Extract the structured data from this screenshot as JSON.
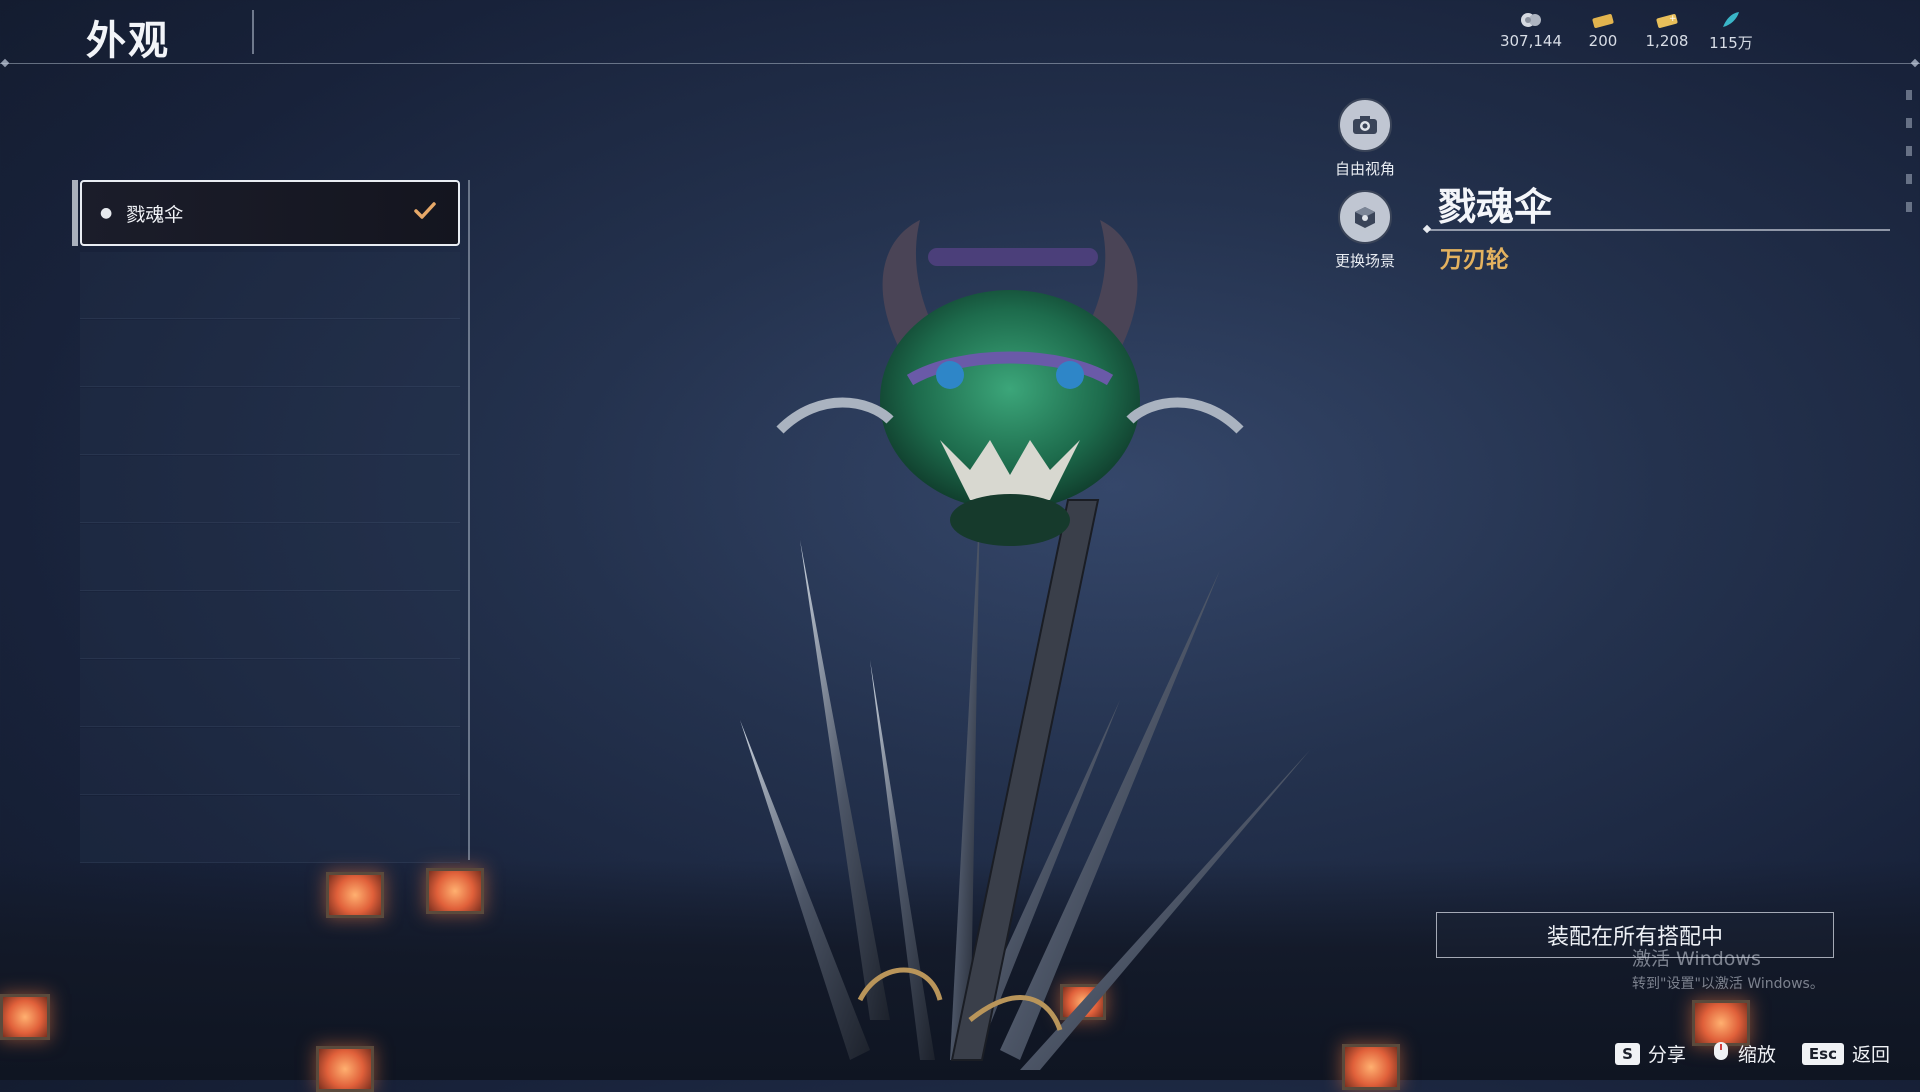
{
  "header": {
    "title": "外观",
    "currencies": [
      {
        "icon": "coin-icon",
        "value": "307,144"
      },
      {
        "icon": "gold-ticket-icon",
        "value": "200"
      },
      {
        "icon": "gold-ticket-plus-icon",
        "value": "1,208"
      },
      {
        "icon": "feather-icon",
        "value": "115万"
      }
    ]
  },
  "list": {
    "items": [
      {
        "label": "戮魂伞",
        "selected": true,
        "checked": true
      }
    ]
  },
  "side_buttons": {
    "free_view": "自由视角",
    "change_scene": "更换场景"
  },
  "item": {
    "name": "戮魂伞",
    "type": "万刃轮"
  },
  "equip_button": "装配在所有搭配中",
  "watermark": {
    "line1": "激活 Windows",
    "line2": "转到\"设置\"以激活 Windows。"
  },
  "hints": [
    {
      "key": "S",
      "label": "分享",
      "icon": "s-key-icon"
    },
    {
      "key": "",
      "label": "缩放",
      "icon": "mouse-icon"
    },
    {
      "key": "Esc",
      "label": "返回",
      "icon": "esc-key-icon"
    }
  ],
  "colors": {
    "accent_gold": "#e4b25f",
    "check": "#e6a868",
    "background": "#24324e"
  }
}
